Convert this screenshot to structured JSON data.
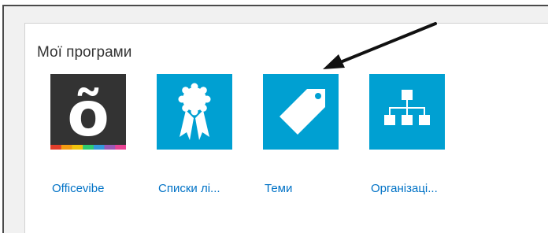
{
  "section": {
    "title": "Мої програми"
  },
  "apps": [
    {
      "label": "Officevibe",
      "icon": "officevibe-logo-icon",
      "bg": "#333333",
      "glyph": "õ"
    },
    {
      "label": "Списки лі...",
      "icon": "ribbon-award-icon",
      "bg": "#00a0d2"
    },
    {
      "label": "Теми",
      "icon": "tag-icon",
      "bg": "#00a0d2"
    },
    {
      "label": "Організаці...",
      "icon": "org-chart-icon",
      "bg": "#00a0d2"
    }
  ],
  "colors": {
    "tile_blue": "#00a0d2",
    "link": "#0072c6",
    "officevibe_bg": "#333333"
  },
  "officevibe_stripe": [
    "#e23e2b",
    "#f39c12",
    "#f1c40f",
    "#2ecc71",
    "#3498db",
    "#9b59b6",
    "#e84393"
  ]
}
